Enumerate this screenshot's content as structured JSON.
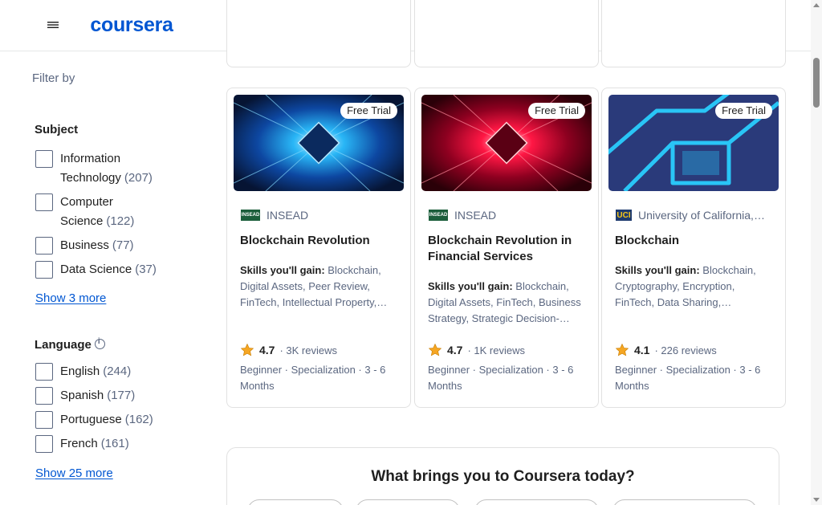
{
  "header": {
    "logo_text": "coursera",
    "menu_icon": "hamburger-menu-icon"
  },
  "sidebar": {
    "filter_by": "Filter by",
    "subject": {
      "title": "Subject",
      "options": [
        {
          "label_line1": "Information",
          "label_line2": "Technology",
          "count": "(207)"
        },
        {
          "label_line1": "Computer",
          "label_line2": "Science",
          "count": "(122)"
        },
        {
          "label_line1": "Business",
          "label_line2": "",
          "count": "(77)"
        },
        {
          "label_line1": "Data Science",
          "label_line2": "",
          "count": "(37)"
        }
      ],
      "show_more": "Show 3 more"
    },
    "language": {
      "title": "Language",
      "options": [
        {
          "label": "English",
          "count": "(244)"
        },
        {
          "label": "Spanish",
          "count": "(177)"
        },
        {
          "label": "Portuguese",
          "count": "(162)"
        },
        {
          "label": "French",
          "count": "(161)"
        }
      ],
      "show_more": "Show 25 more"
    }
  },
  "cards": [
    {
      "badge": "Free Trial",
      "partner": "INSEAD",
      "title": "Blockchain Revolution",
      "skills_label": "Skills you'll gain:",
      "skills": "Blockchain, Digital Assets, Peer Review, FinTech, Intellectual Property,…",
      "rating": "4.7",
      "reviews": "3K reviews",
      "meta": "Beginner · Specialization · 3 - 6 Months",
      "accent": "#1e88e5"
    },
    {
      "badge": "Free Trial",
      "partner": "INSEAD",
      "title": "Blockchain Revolution in Financial Services",
      "skills_label": "Skills you'll gain:",
      "skills": "Blockchain, Digital Assets, FinTech, Business Strategy, Strategic Decision-…",
      "rating": "4.7",
      "reviews": "1K reviews",
      "meta": "Beginner · Specialization · 3 - 6 Months",
      "accent": "#e53935"
    },
    {
      "badge": "Free Trial",
      "partner": "University of California,…",
      "title": "Blockchain",
      "skills_label": "Skills you'll gain:",
      "skills": "Blockchain, Cryptography, Encryption, FinTech, Data Sharing,…",
      "rating": "4.1",
      "reviews": "226 reviews",
      "meta": "Beginner · Specialization · 3 - 6 Months",
      "accent": "#2a3a7a"
    }
  ],
  "bring": {
    "title": "What brings you to Coursera today?"
  },
  "colors": {
    "brand": "#0056d2",
    "star": "#f5a623",
    "muted": "#5b6780"
  }
}
